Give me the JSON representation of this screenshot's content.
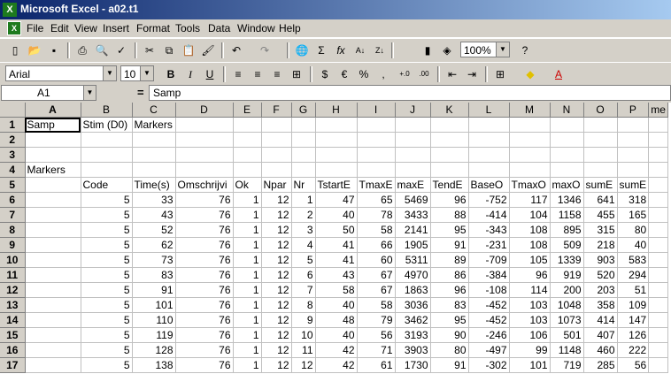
{
  "window": {
    "title": "Microsoft Excel - a02.t1"
  },
  "menu": [
    "File",
    "Edit",
    "View",
    "Insert",
    "Format",
    "Tools",
    "Data",
    "Window",
    "Help"
  ],
  "toolbar": {
    "zoom": "100%",
    "font": "Arial",
    "size": "10"
  },
  "namebox": "A1",
  "formula": "Samp",
  "columns": [
    "A",
    "B",
    "C",
    "D",
    "E",
    "F",
    "G",
    "H",
    "I",
    "J",
    "K",
    "L",
    "M",
    "N",
    "O",
    "P"
  ],
  "col_extra": "me",
  "rows": [
    {
      "num": "1",
      "cells": [
        "Samp",
        "Stim (D0)",
        "Markers",
        "",
        "",
        "",
        "",
        "",
        "",
        "",
        "",
        "",
        "",
        "",
        "",
        ""
      ]
    },
    {
      "num": "2",
      "cells": [
        "",
        "",
        "",
        "",
        "",
        "",
        "",
        "",
        "",
        "",
        "",
        "",
        "",
        "",
        "",
        ""
      ]
    },
    {
      "num": "3",
      "cells": [
        "",
        "",
        "",
        "",
        "",
        "",
        "",
        "",
        "",
        "",
        "",
        "",
        "",
        "",
        "",
        ""
      ]
    },
    {
      "num": "4",
      "cells": [
        "Markers",
        "",
        "",
        "",
        "",
        "",
        "",
        "",
        "",
        "",
        "",
        "",
        "",
        "",
        "",
        ""
      ]
    },
    {
      "num": "5",
      "cells": [
        "",
        "Code",
        "Time(s)",
        "Omschrijvi",
        "Ok",
        "Npar",
        "Nr",
        "TstartE",
        "TmaxE",
        "maxE",
        "TendE",
        "BaseO",
        "TmaxO",
        "maxO",
        "sumE",
        "sumE"
      ]
    },
    {
      "num": "6",
      "cells": [
        "",
        "5",
        "33",
        "76",
        "1",
        "12",
        "1",
        "47",
        "65",
        "5469",
        "96",
        "-752",
        "117",
        "1346",
        "641",
        "318"
      ]
    },
    {
      "num": "7",
      "cells": [
        "",
        "5",
        "43",
        "76",
        "1",
        "12",
        "2",
        "40",
        "78",
        "3433",
        "88",
        "-414",
        "104",
        "1158",
        "455",
        "165"
      ]
    },
    {
      "num": "8",
      "cells": [
        "",
        "5",
        "52",
        "76",
        "1",
        "12",
        "3",
        "50",
        "58",
        "2141",
        "95",
        "-343",
        "108",
        "895",
        "315",
        "80"
      ]
    },
    {
      "num": "9",
      "cells": [
        "",
        "5",
        "62",
        "76",
        "1",
        "12",
        "4",
        "41",
        "66",
        "1905",
        "91",
        "-231",
        "108",
        "509",
        "218",
        "40"
      ]
    },
    {
      "num": "10",
      "cells": [
        "",
        "5",
        "73",
        "76",
        "1",
        "12",
        "5",
        "41",
        "60",
        "5311",
        "89",
        "-709",
        "105",
        "1339",
        "903",
        "583"
      ]
    },
    {
      "num": "11",
      "cells": [
        "",
        "5",
        "83",
        "76",
        "1",
        "12",
        "6",
        "43",
        "67",
        "4970",
        "86",
        "-384",
        "96",
        "919",
        "520",
        "294"
      ]
    },
    {
      "num": "12",
      "cells": [
        "",
        "5",
        "91",
        "76",
        "1",
        "12",
        "7",
        "58",
        "67",
        "1863",
        "96",
        "-108",
        "114",
        "200",
        "203",
        "51"
      ]
    },
    {
      "num": "13",
      "cells": [
        "",
        "5",
        "101",
        "76",
        "1",
        "12",
        "8",
        "40",
        "58",
        "3036",
        "83",
        "-452",
        "103",
        "1048",
        "358",
        "109"
      ]
    },
    {
      "num": "14",
      "cells": [
        "",
        "5",
        "110",
        "76",
        "1",
        "12",
        "9",
        "48",
        "79",
        "3462",
        "95",
        "-452",
        "103",
        "1073",
        "414",
        "147"
      ]
    },
    {
      "num": "15",
      "cells": [
        "",
        "5",
        "119",
        "76",
        "1",
        "12",
        "10",
        "40",
        "56",
        "3193",
        "90",
        "-246",
        "106",
        "501",
        "407",
        "126"
      ]
    },
    {
      "num": "16",
      "cells": [
        "",
        "5",
        "128",
        "76",
        "1",
        "12",
        "11",
        "42",
        "71",
        "3903",
        "80",
        "-497",
        "99",
        "1148",
        "460",
        "222"
      ]
    },
    {
      "num": "17",
      "cells": [
        "",
        "5",
        "138",
        "76",
        "1",
        "12",
        "12",
        "42",
        "61",
        "1730",
        "91",
        "-302",
        "101",
        "719",
        "285",
        "56"
      ]
    }
  ]
}
